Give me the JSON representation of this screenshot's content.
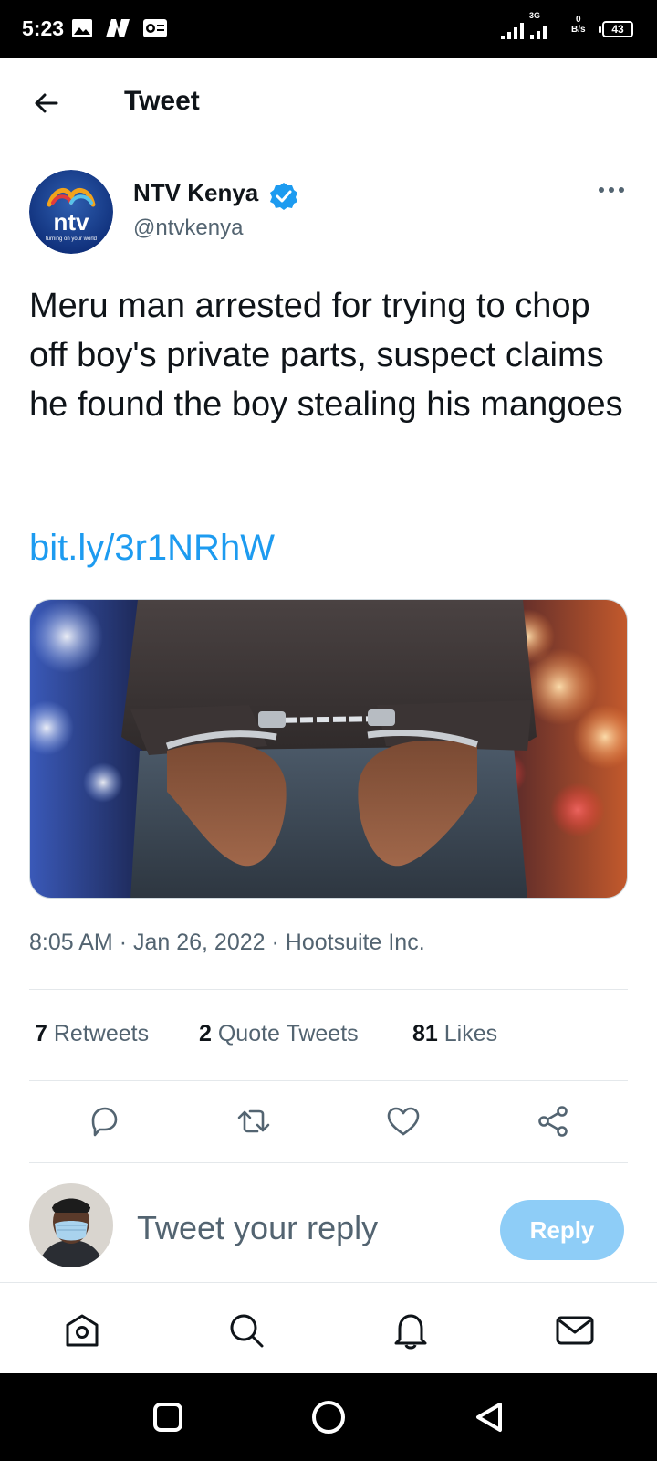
{
  "status_bar": {
    "time": "5:23",
    "network": "3G",
    "speed_value": "0",
    "speed_unit": "B/s",
    "battery": "43"
  },
  "header": {
    "title": "Tweet"
  },
  "tweet": {
    "author_name": "NTV Kenya",
    "author_handle": "@ntvkenya",
    "avatar_logo_text": "ntv",
    "avatar_tagline": "turning on your world",
    "text": "Meru man arrested for trying to chop off boy's private parts, suspect claims he found the boy stealing his mangoes",
    "link": "bit.ly/3r1NRhW",
    "time": "8:05 AM",
    "date": "Jan 26, 2022",
    "source": "Hootsuite Inc.",
    "stats": {
      "retweets_count": "7",
      "retweets_label": "Retweets",
      "quotes_count": "2",
      "quotes_label": "Quote Tweets",
      "likes_count": "81",
      "likes_label": "Likes"
    }
  },
  "reply_bar": {
    "placeholder": "Tweet your reply",
    "button_label": "Reply"
  },
  "colors": {
    "accent": "#1d9bf0",
    "reply_button_disabled": "#8ecdf7",
    "secondary_text": "#536471"
  },
  "icons": {
    "header": "back-arrow-icon",
    "verified": "verified-badge-icon",
    "more": "more-options-icon",
    "actions": [
      "reply-icon",
      "retweet-icon",
      "like-icon",
      "share-icon"
    ],
    "nav": [
      "home-icon",
      "search-icon",
      "notifications-icon",
      "messages-icon"
    ],
    "system": [
      "recents-icon",
      "home-circle-icon",
      "back-triangle-icon"
    ]
  }
}
